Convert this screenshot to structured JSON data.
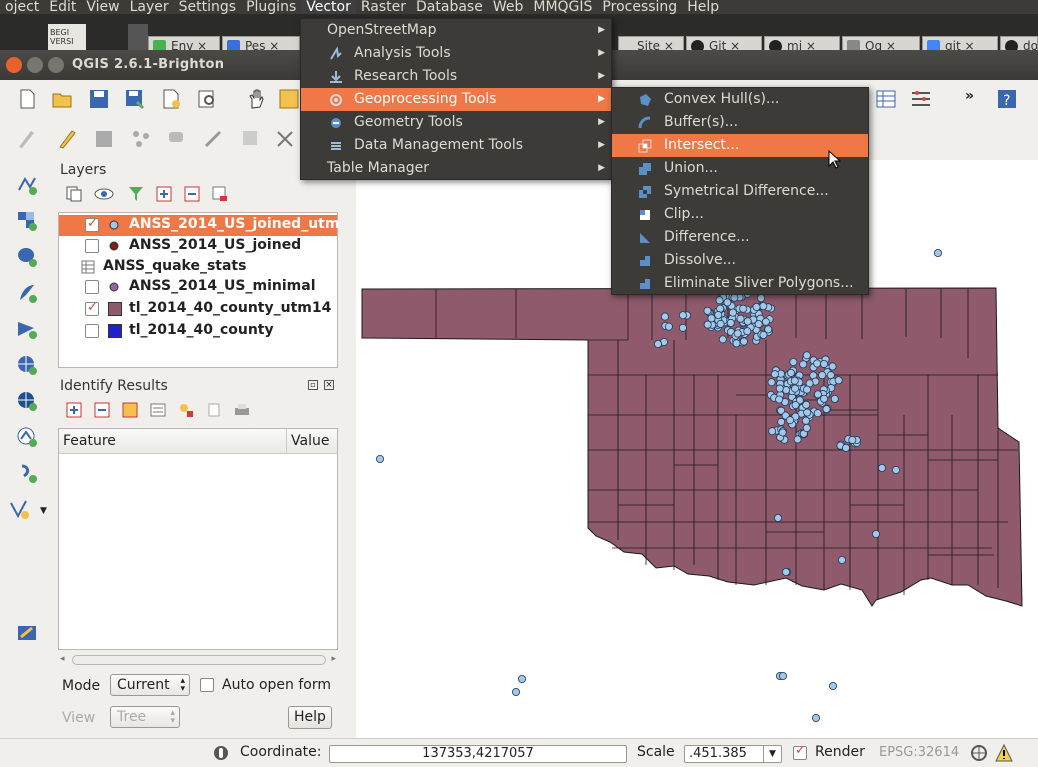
{
  "menubar": {
    "items": [
      "oject",
      "Edit",
      "View",
      "Layer",
      "Settings",
      "Plugins",
      "Vector",
      "Raster",
      "Database",
      "Web",
      "MMQGIS",
      "Processing",
      "Help"
    ]
  },
  "browser": {
    "tabs": [
      "Env",
      "Pes",
      "Site",
      "Git",
      "mi",
      "Oq",
      "git",
      "do"
    ],
    "desk_label_1": "BEGI",
    "desk_label_2": "VERSI"
  },
  "window": {
    "title": "QGIS 2.6.1-Brighton"
  },
  "vector_menu": {
    "items": [
      {
        "label": "OpenStreetMap",
        "icon": "none",
        "submenu": true
      },
      {
        "label": "Analysis Tools",
        "icon": "analysis-icon",
        "submenu": true
      },
      {
        "label": "Research Tools",
        "icon": "research-icon",
        "submenu": true
      },
      {
        "label": "Geoprocessing Tools",
        "icon": "geoprocessing-icon",
        "submenu": true
      },
      {
        "label": "Geometry Tools",
        "icon": "geometry-icon",
        "submenu": true
      },
      {
        "label": "Data Management Tools",
        "icon": "data-management-icon",
        "submenu": true
      },
      {
        "label": "Table Manager",
        "icon": "none",
        "submenu": true
      }
    ]
  },
  "geoprocessing_menu": {
    "items": [
      {
        "label": "Convex Hull(s)...",
        "icon": "convex-hull-icon"
      },
      {
        "label": "Buffer(s)...",
        "icon": "buffer-icon"
      },
      {
        "label": "Intersect...",
        "icon": "intersect-icon"
      },
      {
        "label": "Union...",
        "icon": "union-icon"
      },
      {
        "label": "Symetrical Difference...",
        "icon": "sym-difference-icon"
      },
      {
        "label": "Clip...",
        "icon": "clip-icon"
      },
      {
        "label": "Difference...",
        "icon": "difference-icon"
      },
      {
        "label": "Dissolve...",
        "icon": "dissolve-icon"
      },
      {
        "label": "Eliminate Sliver Polygons...",
        "icon": "eliminate-icon"
      }
    ]
  },
  "layers": {
    "title": "Layers",
    "items": [
      {
        "name": "ANSS_2014_US_joined_utm",
        "checked": true,
        "symbol": "point",
        "color": "#a6c8e8",
        "selected": true
      },
      {
        "name": "ANSS_2014_US_joined",
        "checked": false,
        "symbol": "point",
        "color": "#7a2018",
        "selected": false
      },
      {
        "name": "ANSS_quake_stats",
        "checked": null,
        "symbol": "table",
        "color": "#888888",
        "selected": false
      },
      {
        "name": "ANSS_2014_US_minimal",
        "checked": false,
        "symbol": "point",
        "color": "#9b5fa6",
        "selected": false
      },
      {
        "name": "tl_2014_40_county_utm14",
        "checked": true,
        "symbol": "polygon",
        "color": "#8e5a6c",
        "selected": false
      },
      {
        "name": "tl_2014_40_county",
        "checked": false,
        "symbol": "polygon",
        "color": "#2222cc",
        "selected": false
      }
    ]
  },
  "identify": {
    "title": "Identify Results",
    "col_feature": "Feature",
    "col_value": "Value",
    "mode_label": "Mode",
    "mode_value": "Current",
    "auto_open_label": "Auto open form",
    "view_label": "View",
    "view_value": "Tree",
    "help_label": "Help"
  },
  "status": {
    "coordinate_label": "Coordinate:",
    "coordinate_value": "137353,4217057",
    "scale_label": "Scale",
    "scale_value": ".451.385",
    "render_label": "Render",
    "epsg_label": "EPSG:32614"
  },
  "colors": {
    "accent": "#f07746",
    "county_fill": "#8e5a6c",
    "point_fill": "#a6c8e8",
    "menu_bg": "#3c3b37"
  }
}
